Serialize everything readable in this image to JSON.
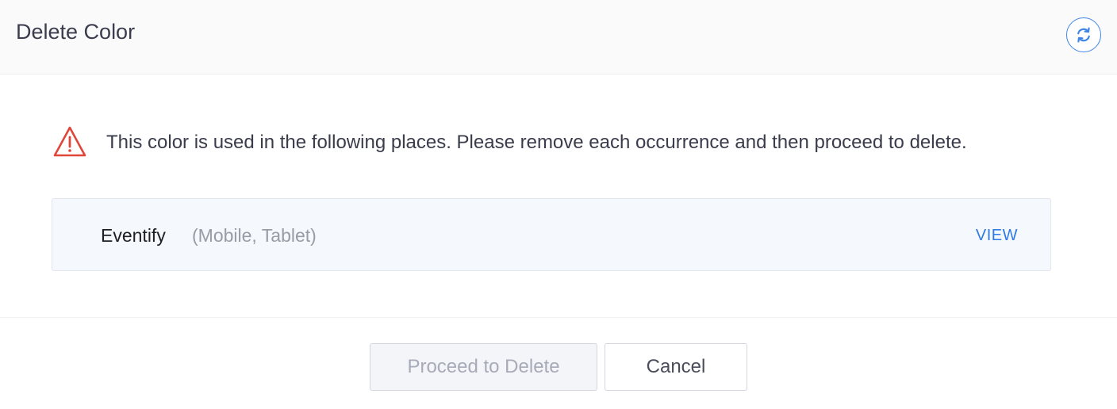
{
  "dialog": {
    "title": "Delete Color",
    "refresh_icon": "refresh-icon"
  },
  "warning": {
    "icon": "warning-triangle-icon",
    "color": "#e0463a",
    "message": "This color is used in the following places. Please remove each occurrence and then proceed to delete."
  },
  "usages": [
    {
      "app_name": "Eventify",
      "platforms": "(Mobile, Tablet)",
      "action_label": "VIEW"
    }
  ],
  "footer": {
    "proceed_label": "Proceed to Delete",
    "cancel_label": "Cancel"
  },
  "colors": {
    "accent": "#2f7ae5",
    "disabled_text": "#a7aab8"
  }
}
